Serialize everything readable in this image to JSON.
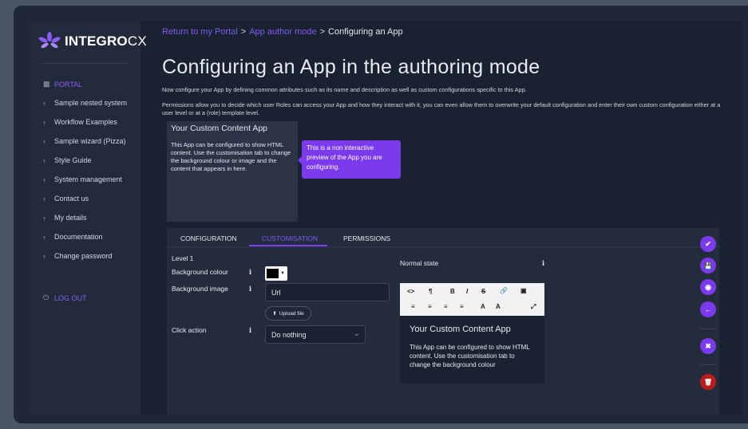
{
  "brand": {
    "logo_bold": "INTEGRO",
    "logo_light": "CX"
  },
  "sidebar": {
    "portal_label": "PORTAL",
    "items": [
      {
        "label": "Sample nested system"
      },
      {
        "label": "Workflow Examples"
      },
      {
        "label": "Sample wizard (Pizza)"
      },
      {
        "label": "Style Guide"
      },
      {
        "label": "System management"
      },
      {
        "label": "Contact us"
      },
      {
        "label": "My details"
      },
      {
        "label": "Documentation"
      },
      {
        "label": "Change password"
      }
    ],
    "logout_label": "LOG OUT"
  },
  "breadcrumb": {
    "link1": "Return to my Portal",
    "link2": "App author mode",
    "current": "Configuring an App",
    "separator": ">"
  },
  "page": {
    "title": "Configuring an App in the authoring mode",
    "intro": "Now configure your App by defining common attributes such as its name and description as well as custom configurations specific to this App.",
    "permissions_text": "Permissions allow you to decide which user Roles can access your App and how they interact with it, you can even allow them to overwrite your default configuration and enter their own custom configuration either at a user level or at a (role) template level."
  },
  "preview": {
    "title": "Your Custom Content App",
    "body": "This App can be configured to show HTML content. Use the customisation tab to change the background colour or image and the content that appears in here.",
    "tooltip": "This is a non interactive preview of the App you are configuring."
  },
  "tabs": [
    {
      "label": "CONFIGURATION",
      "active": false
    },
    {
      "label": "CUSTOMISATION",
      "active": true
    },
    {
      "label": "PERMISSIONS",
      "active": false
    }
  ],
  "form": {
    "level_label": "Level 1",
    "bg_colour_label": "Background colour",
    "bg_colour_value": "#000000",
    "bg_image_label": "Background image",
    "bg_image_value": "Url",
    "upload_label": "Upload file",
    "click_action_label": "Click action",
    "click_action_value": "Do nothing",
    "info_glyph": "i",
    "normal_state_label": "Normal state"
  },
  "editor": {
    "title": "Your Custom Content App",
    "body": "This App can be configured to show HTML content. Use the customisation tab to change the background colour"
  },
  "colors": {
    "accent": "#7c3aed",
    "danger": "#b91c1c",
    "background": "#1a2232"
  },
  "icons": {
    "save": "check-icon",
    "save_draft": "floppy-icon",
    "preview": "eye-icon",
    "back": "arrow-left-icon",
    "cancel": "close-icon",
    "delete": "trash-icon"
  }
}
